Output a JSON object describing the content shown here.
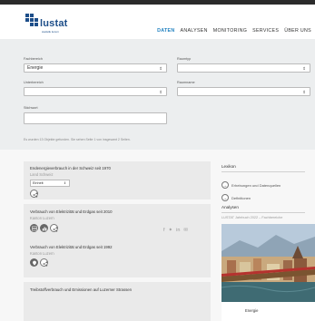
{
  "brand": {
    "name": "lustat",
    "subline": "statistik luzern"
  },
  "nav": {
    "items": [
      "DATEN",
      "ANALYSEN",
      "MONITORING",
      "SERVICES",
      "ÜBER UNS"
    ],
    "active": "DATEN"
  },
  "filter": {
    "fachbereich_label": "Fachbereich",
    "fachbereich_value": "Energie",
    "raumtyp_label": "Raumtyp",
    "raumtyp_value": "",
    "unterbereich_label": "Unterbereich",
    "unterbereich_value": "",
    "raumname_label": "Raumname",
    "raumname_value": "",
    "stichwort_label": "Stichwort",
    "stichwort_value": "",
    "result_note": "Es wurden 13 Objekte gefunden. Sie sehen Seite 1 von insgesamt 2 Seiten."
  },
  "results": [
    {
      "title": "Endenergieverbrauch in der Schweiz seit 1970",
      "sub": "Land Schweiz",
      "select_value": "Einheit",
      "icons": [
        "share-icon"
      ]
    },
    {
      "title": "Verbrauch von Elektrizität und Erdgas seit 2010",
      "sub": "Kanton Luzern",
      "icons": [
        "table-icon",
        "chart-icon",
        "share-icon"
      ]
    },
    {
      "title": "Verbrauch von Elektrizität und Erdgas seit 1992",
      "sub": "Kanton Luzern",
      "icons": [
        "map-icon",
        "share-icon"
      ]
    },
    {
      "title": "Treibstoffverbrauch und Emissionen auf Luzerner Strassen",
      "sub": ""
    }
  ],
  "share": {
    "icons": [
      "facebook-icon",
      "twitter-icon",
      "linkedin-icon",
      "email-icon"
    ]
  },
  "sidebar": {
    "lexikon_heading": "Lexikon",
    "lexikon_links": [
      "Erhebungen und Datenquellen",
      "Definitionen"
    ],
    "analysen_heading": "Analysen",
    "analysen_sub": "LUSTAT Jahrbuch 2022 – Fachbereiche",
    "caption": "Energie"
  },
  "colors": {
    "accent": "#1d7fbf",
    "brand": "#1d4e89",
    "filter_bg": "#eceeef",
    "card_bg": "#eaeaea"
  }
}
